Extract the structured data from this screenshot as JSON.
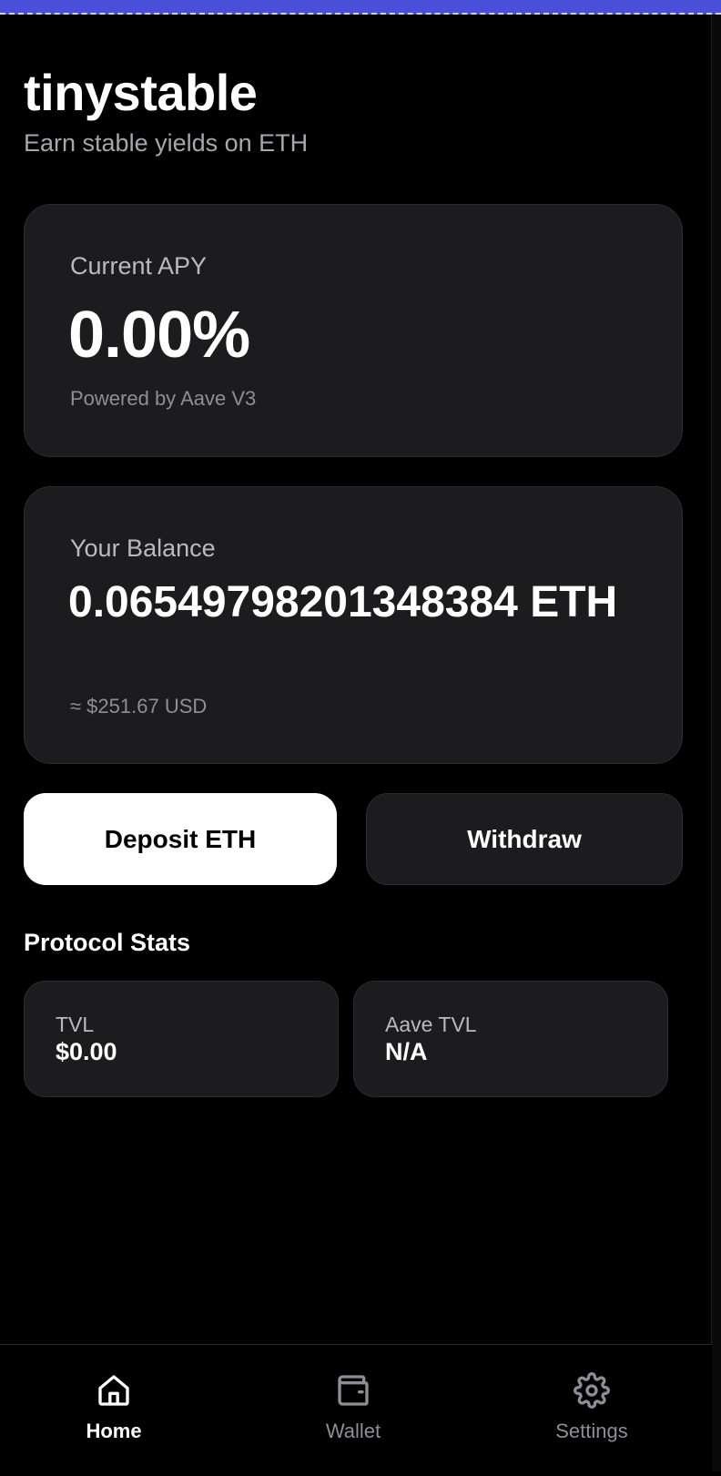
{
  "app": {
    "title": "tinystable",
    "subtitle": "Earn stable yields on ETH"
  },
  "apy_card": {
    "label": "Current APY",
    "value": "0.00%",
    "note": "Powered by Aave V3"
  },
  "balance_card": {
    "label": "Your Balance",
    "value": "0.06549798201348384 ETH",
    "usd": "≈ $251.67 USD"
  },
  "actions": {
    "deposit_label": "Deposit ETH",
    "withdraw_label": "Withdraw"
  },
  "stats": {
    "title": "Protocol Stats",
    "tvl_label": "TVL",
    "tvl_value": "$0.00",
    "aave_tvl_label": "Aave TVL",
    "aave_tvl_value": "N/A"
  },
  "nav": {
    "active": "Home",
    "items": [
      {
        "label": "Home",
        "icon": "home-icon"
      },
      {
        "label": "Wallet",
        "icon": "wallet-icon"
      },
      {
        "label": "Settings",
        "icon": "gear-icon"
      }
    ]
  },
  "colors": {
    "accent_bar": "#4a4fd9",
    "background": "#000000",
    "card": "#1c1c1f",
    "muted_text": "#8e8e96"
  }
}
